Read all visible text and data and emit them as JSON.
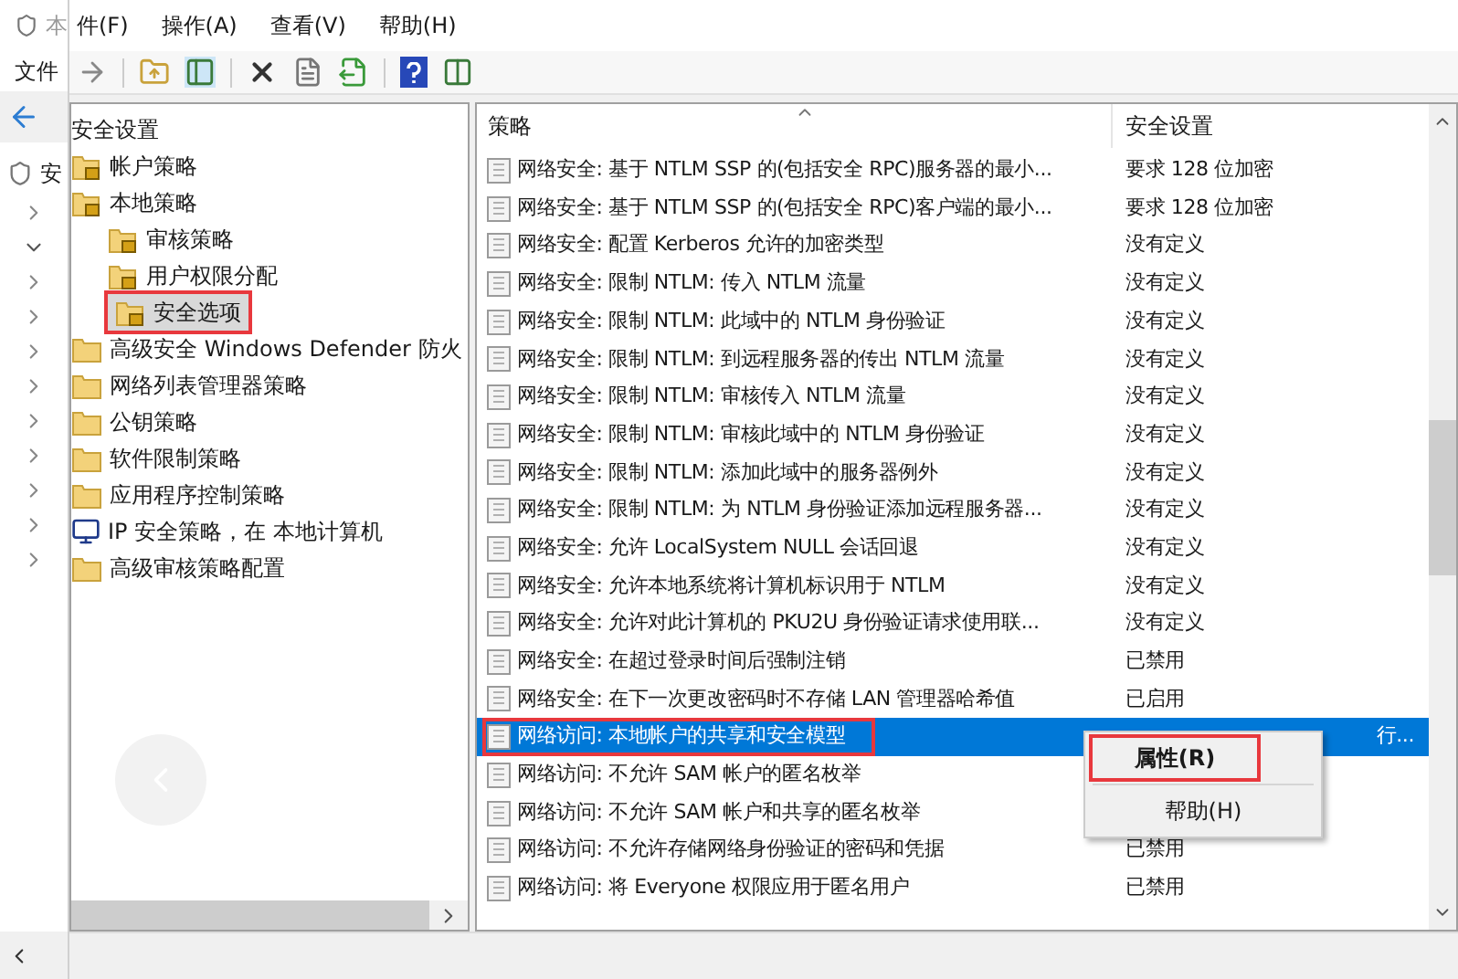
{
  "back_window": {
    "title": "本",
    "menu": [
      "文件"
    ],
    "tree_item": "安"
  },
  "menu": [
    "件(F)",
    "操作(A)",
    "查看(V)",
    "帮助(H)"
  ],
  "tree": {
    "label": "安全设置",
    "children": [
      {
        "label": "帐户策略",
        "kind": "locked",
        "selected": false,
        "highlighted": false
      },
      {
        "label": "本地策略",
        "kind": "locked",
        "selected": false,
        "highlighted": false,
        "children": [
          {
            "label": "审核策略",
            "kind": "locked",
            "selected": false,
            "highlighted": false
          },
          {
            "label": "用户权限分配",
            "kind": "locked",
            "selected": false,
            "highlighted": false
          },
          {
            "label": "安全选项",
            "kind": "locked",
            "selected": true,
            "highlighted": true
          }
        ]
      },
      {
        "label": "高级安全 Windows Defender 防火",
        "kind": "folder",
        "selected": false,
        "highlighted": false
      },
      {
        "label": "网络列表管理器策略",
        "kind": "folder",
        "selected": false,
        "highlighted": false
      },
      {
        "label": "公钥策略",
        "kind": "folder",
        "selected": false,
        "highlighted": false
      },
      {
        "label": "软件限制策略",
        "kind": "folder",
        "selected": false,
        "highlighted": false
      },
      {
        "label": "应用程序控制策略",
        "kind": "folder",
        "selected": false,
        "highlighted": false
      },
      {
        "label": "IP 安全策略，在 本地计算机",
        "kind": "computer",
        "selected": false,
        "highlighted": false
      },
      {
        "label": "高级审核策略配置",
        "kind": "folder",
        "selected": false,
        "highlighted": false
      }
    ]
  },
  "table": {
    "columns": [
      "策略",
      "安全设置"
    ],
    "rows": [
      {
        "policy": "网络安全: 基于 NTLM SSP 的(包括安全 RPC)服务器的最小...",
        "setting": "要求 128 位加密",
        "selected": false,
        "highlighted": false
      },
      {
        "policy": "网络安全: 基于 NTLM SSP 的(包括安全 RPC)客户端的最小...",
        "setting": "要求 128 位加密",
        "selected": false,
        "highlighted": false
      },
      {
        "policy": "网络安全: 配置 Kerberos 允许的加密类型",
        "setting": "没有定义",
        "selected": false,
        "highlighted": false
      },
      {
        "policy": "网络安全: 限制 NTLM: 传入 NTLM 流量",
        "setting": "没有定义",
        "selected": false,
        "highlighted": false
      },
      {
        "policy": "网络安全: 限制 NTLM: 此域中的 NTLM 身份验证",
        "setting": "没有定义",
        "selected": false,
        "highlighted": false
      },
      {
        "policy": "网络安全: 限制 NTLM: 到远程服务器的传出 NTLM 流量",
        "setting": "没有定义",
        "selected": false,
        "highlighted": false
      },
      {
        "policy": "网络安全: 限制 NTLM: 审核传入 NTLM 流量",
        "setting": "没有定义",
        "selected": false,
        "highlighted": false
      },
      {
        "policy": "网络安全: 限制 NTLM: 审核此域中的 NTLM 身份验证",
        "setting": "没有定义",
        "selected": false,
        "highlighted": false
      },
      {
        "policy": "网络安全: 限制 NTLM: 添加此域中的服务器例外",
        "setting": "没有定义",
        "selected": false,
        "highlighted": false
      },
      {
        "policy": "网络安全: 限制 NTLM: 为 NTLM 身份验证添加远程服务器...",
        "setting": "没有定义",
        "selected": false,
        "highlighted": false
      },
      {
        "policy": "网络安全: 允许 LocalSystem NULL 会话回退",
        "setting": "没有定义",
        "selected": false,
        "highlighted": false
      },
      {
        "policy": "网络安全: 允许本地系统将计算机标识用于 NTLM",
        "setting": "没有定义",
        "selected": false,
        "highlighted": false
      },
      {
        "policy": "网络安全: 允许对此计算机的 PKU2U 身份验证请求使用联...",
        "setting": "没有定义",
        "selected": false,
        "highlighted": false
      },
      {
        "policy": "网络安全: 在超过登录时间后强制注销",
        "setting": "已禁用",
        "selected": false,
        "highlighted": false
      },
      {
        "policy": "网络安全: 在下一次更改密码时不存储 LAN 管理器哈希值",
        "setting": "已启用",
        "selected": false,
        "highlighted": false
      },
      {
        "policy": "网络访问: 本地帐户的共享和安全模型",
        "setting": "行...",
        "selected": true,
        "highlighted": true
      },
      {
        "policy": "网络访问: 不允许 SAM 帐户的匿名枚举",
        "selected": false,
        "highlighted": false
      },
      {
        "policy": "网络访问: 不允许 SAM 帐户和共享的匿名枚举",
        "selected": false,
        "highlighted": false
      },
      {
        "policy": "网络访问: 不允许存储网络身份验证的密码和凭据",
        "setting": "已禁用",
        "selected": false,
        "highlighted": false
      },
      {
        "policy": "网络访问: 将 Everyone 权限应用于匿名用户",
        "setting": "已禁用",
        "selected": false,
        "highlighted": false
      }
    ]
  },
  "context_menu": {
    "items": [
      {
        "label": "属性(R)",
        "highlighted": true
      },
      {
        "label": "帮助(H)",
        "highlighted": false
      }
    ]
  }
}
